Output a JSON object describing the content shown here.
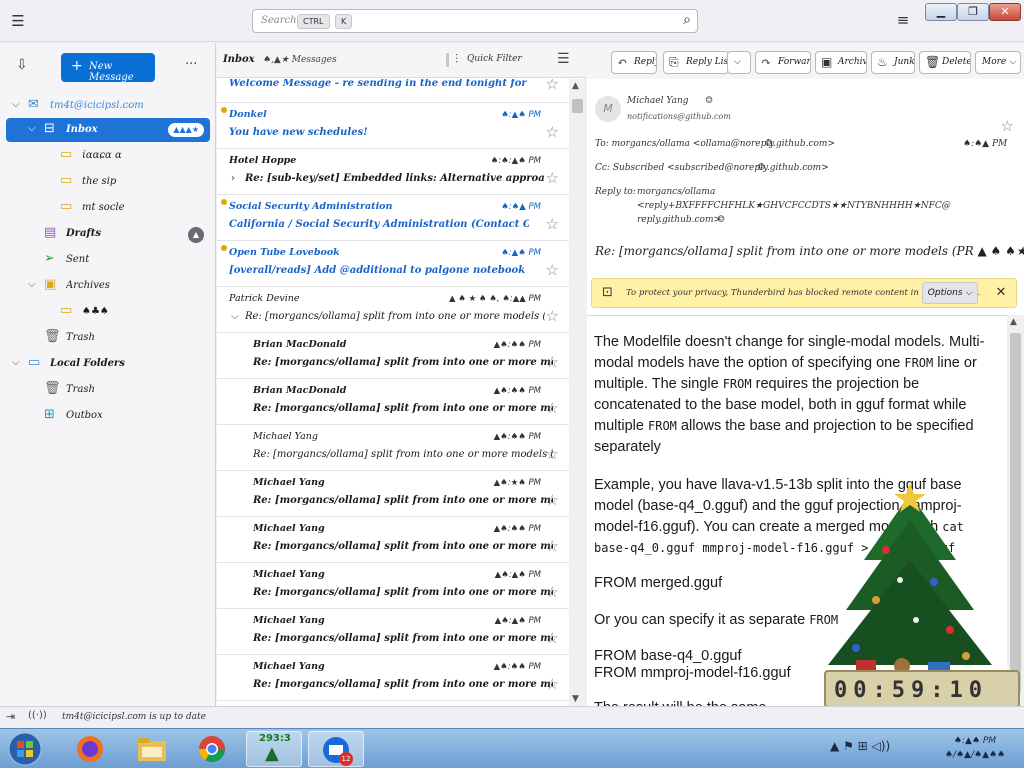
{
  "window": {
    "search_placeholder": "Search...",
    "kbd_ctrl": "CTRL",
    "kbd_k": "K"
  },
  "folders": {
    "new_message": "New Message",
    "items": [
      {
        "name": "tm4t@icicipsl.com",
        "icon": "mail-account-icon"
      },
      {
        "name": "Inbox",
        "badge": "▲▲▲★",
        "icon": "inbox-icon"
      },
      {
        "name": "ίɑαɕɑ α",
        "icon": "folder-icon"
      },
      {
        "name": "the sip",
        "icon": "folder-icon"
      },
      {
        "name": "mt socle",
        "icon": "folder-icon"
      },
      {
        "name": "Drafts",
        "badge": "▲",
        "icon": "drafts-icon"
      },
      {
        "name": "Sent",
        "icon": "sent-icon"
      },
      {
        "name": "Archives",
        "icon": "archive-icon"
      },
      {
        "name": "♠♣♠",
        "icon": "folder-icon"
      },
      {
        "name": "Trash",
        "icon": "trash-icon"
      },
      {
        "name": "Local Folders",
        "icon": "local-folders-icon"
      },
      {
        "name": "Trash",
        "icon": "trash-icon"
      },
      {
        "name": "Outbox",
        "icon": "outbox-icon"
      }
    ]
  },
  "list": {
    "folder_name": "Inbox",
    "count": "♠,▲★ Messages",
    "quick_filter": "Quick Filter",
    "rows": [
      {
        "from": "",
        "subject": "Welcome Message - re sending in the end tonight for best scoring key ≡-",
        "date": "",
        "unread": true,
        "blue": true
      },
      {
        "from": "Donkel",
        "subject": "You have new schedules!",
        "date": "♠:▲♠ PM",
        "unread": true,
        "blue": true
      },
      {
        "from": "Hotel Hoppe",
        "subject": "Re: [sub-key/set] Embedded links: Alternative approach to the weight...",
        "date": "♠:♠:▲♠ PM",
        "unread": true,
        "blue": false
      },
      {
        "from": "Social Security Administration",
        "subject": "California / Social Security Administration (Contact Online)",
        "date": "♠:♠▲ PM",
        "unread": true,
        "blue": true
      },
      {
        "from": "Open Tube Lovebook",
        "subject": "[overall/reads] Add @additional to palgone notebook (PR ▲★▼♠ ...",
        "date": "♠:▲♠ PM",
        "unread": true,
        "blue": true
      },
      {
        "from": "Patrick Devine",
        "subject": "Re: [morgancs/ollama] split from into one or more models (PR ▲ ♠ ♠ ★)",
        "date": "▲ ♠ ★ ♠ ♠, ♠:▲▲ PM",
        "unread": false,
        "blue": false
      },
      {
        "from": "Brian MacDonald",
        "subject": "Re: [morgancs/ollama] split from into one or more models (PR ▲ ♠...",
        "date": "▲♠:♠♠ PM",
        "unread": true,
        "blue": false
      },
      {
        "from": "Brian MacDonald",
        "subject": "Re: [morgancs/ollama] split from into one or more models (PR ▲ ♠...",
        "date": "▲♠:♠♠ PM",
        "unread": true,
        "blue": false
      },
      {
        "from": "Michael Yang",
        "subject": "Re: [morgancs/ollama] split from into one or more models (PR ▲ ♠ ♠★)",
        "date": "▲♠:♠♠ PM",
        "unread": false,
        "blue": false
      },
      {
        "from": "Michael Yang",
        "subject": "Re: [morgancs/ollama] split from into one or more models (PR ▲ ♠...",
        "date": "▲♠:★♠ PM",
        "unread": true,
        "blue": false
      },
      {
        "from": "Michael Yang",
        "subject": "Re: [morgancs/ollama] split from into one or more models (PR ▲ ♠...",
        "date": "▲♠:♠♠ PM",
        "unread": true,
        "blue": false
      },
      {
        "from": "Michael Yang",
        "subject": "Re: [morgancs/ollama] split from into one or more models (PR ▲ ♠...",
        "date": "▲♠:▲♠ PM",
        "unread": true,
        "blue": false
      },
      {
        "from": "Michael Yang",
        "subject": "Re: [morgancs/ollama] split from into one or more models (PR ▲ ♠...",
        "date": "▲♠:▲♠ PM",
        "unread": true,
        "blue": false
      },
      {
        "from": "Michael Yang",
        "subject": "Re: [morgancs/ollama] split from into one or more models (PR ▲ ♠...",
        "date": "▲♠:♠♠ PM",
        "unread": true,
        "blue": false
      }
    ]
  },
  "reader": {
    "buttons": [
      "Reply",
      "Reply List",
      "Forward",
      "Archive",
      "Junk",
      "Delete",
      "More"
    ],
    "sender": "Michael Yang",
    "sender_email": "notifications@github.com",
    "to_line": "To: morgancs/ollama <ollama@noreply.github.com>",
    "cc_line": "Cc: Subscribed <subscribed@noreply.github.com>",
    "reply_to_label": "Reply to:",
    "reply_to_1": "morgancs/ollama",
    "reply_to_2": "<reply+BXFFFFCHFHLK★GHVCFCCDTS★★NTYBNHHHH★NFC@",
    "reply_to_3": "reply.github.com>",
    "date": "♠:♠▲ PM",
    "subject": "Re: [morgancs/ollama] split from into one or more models (PR ▲ ♠ ♠★)",
    "notif_text": "To protect your privacy, Thunderbird has blocked remote content in this message.",
    "notif_options": "Options",
    "para1_a": "The Modelfile doesn't change for single-modal models. Multi-modal models have the option of specifying one ",
    "para1_code1": "FROM",
    "para1_b": " line or multiple. The single ",
    "para1_code2": "FROM",
    "para1_c": " requires the projection be concatenated to the base model, both in gguf format while multiple ",
    "para1_code3": "FROM",
    "para1_d": " allows the base and projection to be specified separately",
    "para2_a": "Example, you have llava-v1.5-13b split into the gguf base model (base-q4_0.gguf) and the gguf projection (mmproj-model-f16.gguf). You can create a merged model with ",
    "para2_code": "cat base-q4_0.gguf mmproj-model-f16.gguf > merged.gguf",
    "code_block1": "FROM merged.gguf",
    "para3_a": "Or you can specify it as separate ",
    "para3_code": "FROM",
    "code_block2a": "FROM base-q4_0.gguf",
    "code_block2b": "FROM mmproj-model-f16.gguf",
    "para4": "The result will be the same"
  },
  "xmas": {
    "counter": "00:59:10"
  },
  "status": {
    "text": "tm4t@icicipsl.com is up to date"
  },
  "taskbar": {
    "clock_time": "♠:▲♠ PM",
    "clock_date": "♠/♠▲/♠▲♠♠",
    "active_label": "293:3",
    "badge": "12"
  }
}
